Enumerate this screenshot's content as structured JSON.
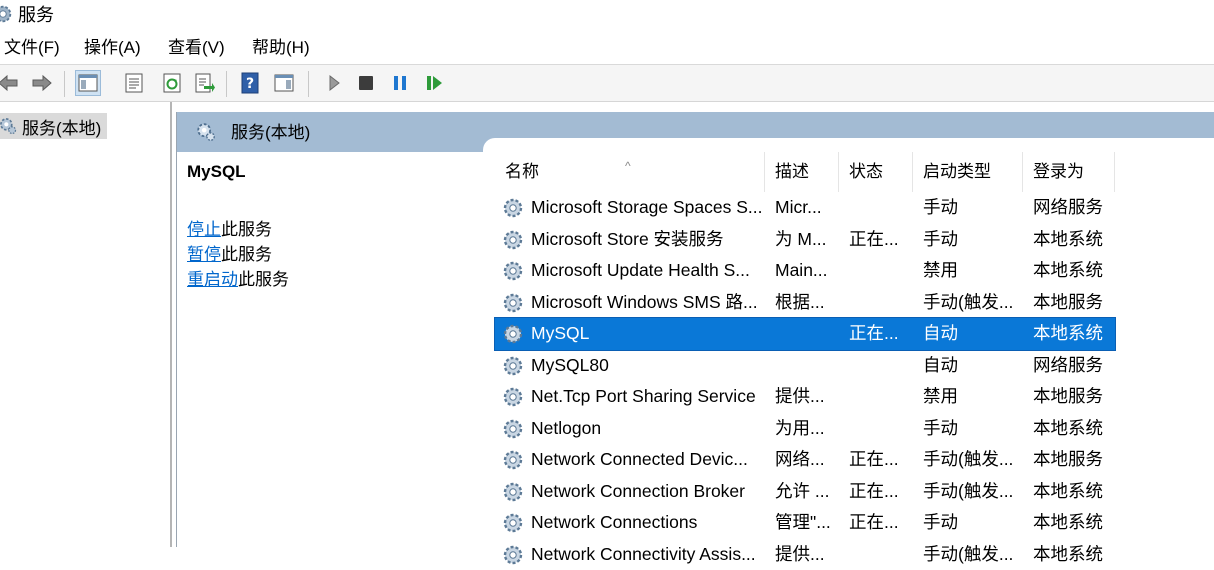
{
  "window": {
    "title": "服务"
  },
  "menu": [
    {
      "label": "文件(F)"
    },
    {
      "label": "操作(A)"
    },
    {
      "label": "查看(V)"
    },
    {
      "label": "帮助(H)"
    }
  ],
  "toolbar": {
    "buttons": [
      "back-arrow-icon",
      "forward-arrow-icon",
      "show-hide-tree-icon",
      "properties-icon",
      "refresh-icon",
      "export-list-icon",
      "help-icon",
      "show-hide-action-pane-icon",
      "start-service-icon",
      "stop-service-icon",
      "pause-service-icon",
      "restart-service-icon"
    ]
  },
  "tree": {
    "root_label": "服务(本地)"
  },
  "pane": {
    "title": "服务(本地)"
  },
  "description": {
    "service_name": "MySQL",
    "actions": [
      {
        "link": "停止",
        "suffix": "此服务"
      },
      {
        "link": "暂停",
        "suffix": "此服务"
      },
      {
        "link": "重启动",
        "suffix": "此服务"
      }
    ]
  },
  "table": {
    "columns": [
      "名称",
      "描述",
      "状态",
      "启动类型",
      "登录为"
    ],
    "sort_glyph": "^",
    "rows": [
      {
        "name": "Microsoft Storage Spaces S...",
        "desc": "Micr...",
        "status": "",
        "startup": "手动",
        "logon": "网络服务"
      },
      {
        "name": "Microsoft Store 安装服务",
        "desc": "为 M...",
        "status": "正在...",
        "startup": "手动",
        "logon": "本地系统"
      },
      {
        "name": "Microsoft Update Health S...",
        "desc": "Main...",
        "status": "",
        "startup": "禁用",
        "logon": "本地系统"
      },
      {
        "name": "Microsoft Windows SMS 路...",
        "desc": "根据...",
        "status": "",
        "startup": "手动(触发...",
        "logon": "本地服务"
      },
      {
        "name": "MySQL",
        "desc": "",
        "status": "正在...",
        "startup": "自动",
        "logon": "本地系统",
        "selected": true
      },
      {
        "name": "MySQL80",
        "desc": "",
        "status": "",
        "startup": "自动",
        "logon": "网络服务"
      },
      {
        "name": "Net.Tcp Port Sharing Service",
        "desc": "提供...",
        "status": "",
        "startup": "禁用",
        "logon": "本地服务"
      },
      {
        "name": "Netlogon",
        "desc": "为用...",
        "status": "",
        "startup": "手动",
        "logon": "本地系统"
      },
      {
        "name": "Network Connected Devic...",
        "desc": "网络...",
        "status": "正在...",
        "startup": "手动(触发...",
        "logon": "本地服务"
      },
      {
        "name": "Network Connection Broker",
        "desc": "允许 ...",
        "status": "正在...",
        "startup": "手动(触发...",
        "logon": "本地系统"
      },
      {
        "name": "Network Connections",
        "desc": "管理\"...",
        "status": "正在...",
        "startup": "手动",
        "logon": "本地系统"
      },
      {
        "name": "Network Connectivity Assis...",
        "desc": "提供...",
        "status": "",
        "startup": "手动(触发...",
        "logon": "本地系统"
      }
    ]
  },
  "colors": {
    "selection": "#0a78d7",
    "pane_header": "#a3bbd3",
    "link": "#0066cc"
  }
}
